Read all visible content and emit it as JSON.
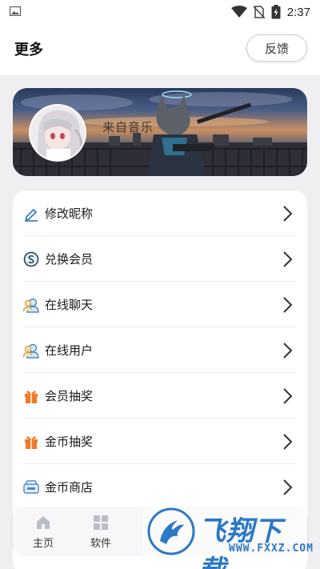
{
  "status_bar": {
    "time": "2:37",
    "icons": [
      "image-icon",
      "wifi-icon",
      "no-sim-icon",
      "battery-charging-icon"
    ]
  },
  "header": {
    "title": "更多",
    "feedback_label": "反馈"
  },
  "banner": {
    "name": "来自音乐"
  },
  "menu": {
    "items": [
      {
        "label": "修改昵称",
        "icon": "edit-pen-icon"
      },
      {
        "label": "兑换会员",
        "icon": "exchange-coin-icon"
      },
      {
        "label": "在线聊天",
        "icon": "chat-users-icon"
      },
      {
        "label": "在线用户",
        "icon": "online-users-icon"
      },
      {
        "label": "会员抽奖",
        "icon": "gift-icon"
      },
      {
        "label": "金币抽奖",
        "icon": "gift-icon"
      },
      {
        "label": "金币商店",
        "icon": "store-icon"
      }
    ]
  },
  "bottom_nav": {
    "items": [
      {
        "label": "主页",
        "icon": "home-icon"
      },
      {
        "label": "软件",
        "icon": "apps-icon"
      }
    ]
  },
  "watermark": {
    "title": "飞翔下载",
    "url": "WWW.FXXZ.COM"
  },
  "colors": {
    "accent_blue": "#2b78c7",
    "gift_orange": "#f07a2a",
    "chat_blue": "#4c86c9",
    "background": "#efeff1"
  }
}
